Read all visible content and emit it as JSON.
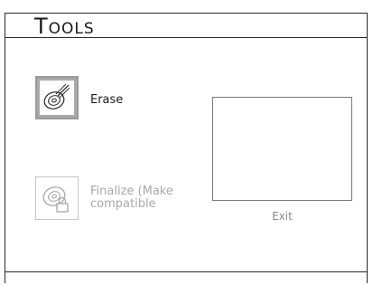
{
  "header": {
    "title": "Tools"
  },
  "menu": {
    "items": [
      {
        "label": "Erase",
        "icon": "disc-erase-icon",
        "state": "selected"
      },
      {
        "label": "Finalize (Make compatible",
        "icon": "disc-lock-icon",
        "state": "disabled"
      }
    ]
  },
  "preview": {
    "exit_label": "Exit"
  },
  "colors": {
    "selection_bg": "#a9a9a9",
    "disabled_text": "#a8a8a8",
    "border": "#2a2a2a"
  }
}
